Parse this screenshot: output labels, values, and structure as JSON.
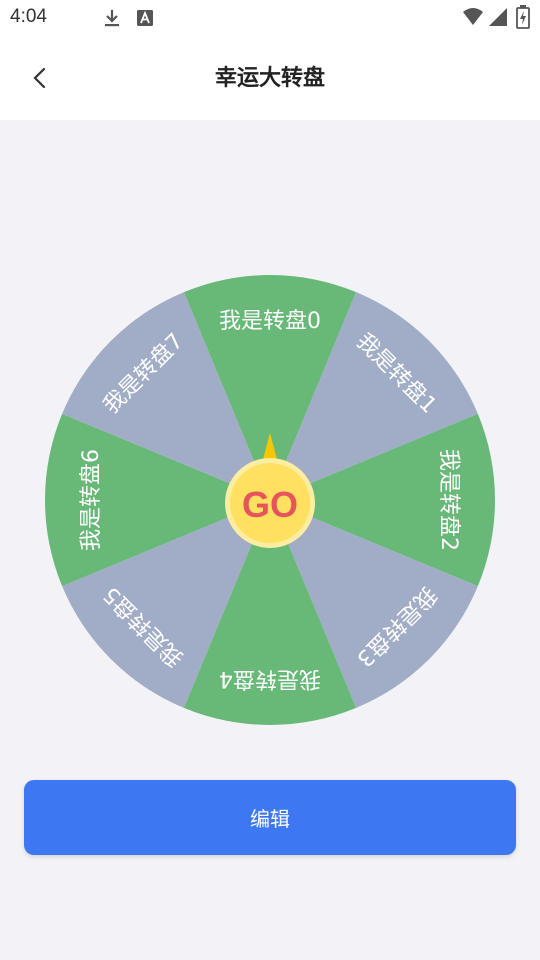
{
  "status_bar": {
    "time": "4:04",
    "icons": [
      "download-icon",
      "a-badge-icon",
      "wifi-icon",
      "signal-icon",
      "battery-icon"
    ]
  },
  "header": {
    "back_icon": "chevron-left-icon",
    "title": "幸运大转盘"
  },
  "wheel": {
    "segments": [
      {
        "label": "我是转盘0",
        "color": "#68b878"
      },
      {
        "label": "我是转盘1",
        "color": "#a1acc6"
      },
      {
        "label": "我是转盘2",
        "color": "#68b878"
      },
      {
        "label": "我是转盘3",
        "color": "#a1acc6"
      },
      {
        "label": "我是转盘4",
        "color": "#68b878"
      },
      {
        "label": "我是转盘5",
        "color": "#a1acc6"
      },
      {
        "label": "我是转盘6",
        "color": "#68b878"
      },
      {
        "label": "我是转盘7",
        "color": "#a1acc6"
      }
    ],
    "go_label": "GO",
    "go_color": "#e8545b",
    "go_fill": "#ffe060",
    "pointer_color": "#f5c800"
  },
  "actions": {
    "edit_label": "编辑",
    "edit_color": "#3d77f1"
  }
}
